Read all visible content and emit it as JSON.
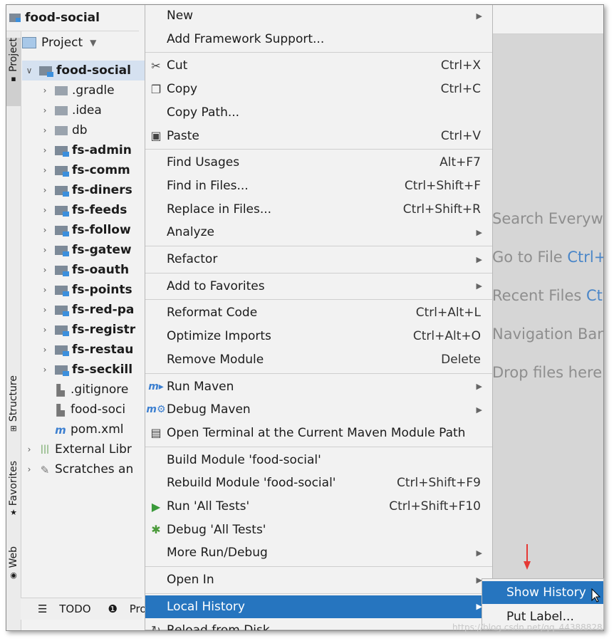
{
  "project": {
    "name": "food-social",
    "view_label": "Project"
  },
  "side_tabs": {
    "project": "Project",
    "structure": "Structure",
    "favorites": "Favorites",
    "web": "Web"
  },
  "tree": [
    {
      "label": "food-social",
      "bold": true,
      "arrow": "∨",
      "icon": "module-folder",
      "selected": true
    },
    {
      "label": ".gradle",
      "arrow": "›",
      "icon": "folder"
    },
    {
      "label": ".idea",
      "arrow": "›",
      "icon": "folder"
    },
    {
      "label": "db",
      "arrow": "›",
      "icon": "folder"
    },
    {
      "label": "fs-admin",
      "bold": true,
      "arrow": "›",
      "icon": "module-folder"
    },
    {
      "label": "fs-comm",
      "bold": true,
      "arrow": "›",
      "icon": "module-folder"
    },
    {
      "label": "fs-diners",
      "bold": true,
      "arrow": "›",
      "icon": "module-folder"
    },
    {
      "label": "fs-feeds",
      "bold": true,
      "arrow": "›",
      "icon": "module-folder"
    },
    {
      "label": "fs-follow",
      "bold": true,
      "arrow": "›",
      "icon": "module-folder"
    },
    {
      "label": "fs-gatew",
      "bold": true,
      "arrow": "›",
      "icon": "module-folder"
    },
    {
      "label": "fs-oauth",
      "bold": true,
      "arrow": "›",
      "icon": "module-folder"
    },
    {
      "label": "fs-points",
      "bold": true,
      "arrow": "›",
      "icon": "module-folder"
    },
    {
      "label": "fs-red-pa",
      "bold": true,
      "arrow": "›",
      "icon": "module-folder"
    },
    {
      "label": "fs-registr",
      "bold": true,
      "arrow": "›",
      "icon": "module-folder"
    },
    {
      "label": "fs-restau",
      "bold": true,
      "arrow": "›",
      "icon": "module-folder"
    },
    {
      "label": "fs-seckill",
      "bold": true,
      "arrow": "›",
      "icon": "module-folder"
    },
    {
      "label": ".gitignore",
      "arrow": "",
      "icon": "gitignore-file"
    },
    {
      "label": "food-soci",
      "arrow": "",
      "icon": "iml-file"
    },
    {
      "label": "pom.xml",
      "arrow": "",
      "icon": "maven-file"
    },
    {
      "label": "External Libr",
      "arrow": "›",
      "icon": "library"
    },
    {
      "label": "Scratches an",
      "arrow": "›",
      "icon": "scratches"
    }
  ],
  "bottom_tabs": {
    "todo": "TODO",
    "problems": "Probl"
  },
  "editor_hints": [
    {
      "text": "Search Everywh",
      "key": ""
    },
    {
      "text": "Go to File ",
      "key": "Ctrl+"
    },
    {
      "text": "Recent Files ",
      "key": "Ct"
    },
    {
      "text": "Navigation Bar",
      "key": ""
    },
    {
      "text": "Drop files here",
      "key": ""
    }
  ],
  "menu": [
    {
      "label": "New",
      "shortcut": "",
      "submenu": true,
      "icon": ""
    },
    {
      "label": "Add Framework Support...",
      "shortcut": "",
      "submenu": false,
      "icon": ""
    },
    {
      "sep": true
    },
    {
      "label": "Cut",
      "shortcut": "Ctrl+X",
      "submenu": false,
      "icon": "✂"
    },
    {
      "label": "Copy",
      "shortcut": "Ctrl+C",
      "submenu": false,
      "icon": "❐"
    },
    {
      "label": "Copy Path...",
      "shortcut": "",
      "submenu": false,
      "icon": ""
    },
    {
      "label": "Paste",
      "shortcut": "Ctrl+V",
      "submenu": false,
      "icon": "▣"
    },
    {
      "sep": true
    },
    {
      "label": "Find Usages",
      "shortcut": "Alt+F7",
      "submenu": false,
      "icon": ""
    },
    {
      "label": "Find in Files...",
      "shortcut": "Ctrl+Shift+F",
      "submenu": false,
      "icon": ""
    },
    {
      "label": "Replace in Files...",
      "shortcut": "Ctrl+Shift+R",
      "submenu": false,
      "icon": ""
    },
    {
      "label": "Analyze",
      "shortcut": "",
      "submenu": true,
      "icon": ""
    },
    {
      "sep": true
    },
    {
      "label": "Refactor",
      "shortcut": "",
      "submenu": true,
      "icon": ""
    },
    {
      "sep": true
    },
    {
      "label": "Add to Favorites",
      "shortcut": "",
      "submenu": true,
      "icon": ""
    },
    {
      "sep": true
    },
    {
      "label": "Reformat Code",
      "shortcut": "Ctrl+Alt+L",
      "submenu": false,
      "icon": ""
    },
    {
      "label": "Optimize Imports",
      "shortcut": "Ctrl+Alt+O",
      "submenu": false,
      "icon": ""
    },
    {
      "label": "Remove Module",
      "shortcut": "Delete",
      "submenu": false,
      "icon": ""
    },
    {
      "sep": true
    },
    {
      "label": "Run Maven",
      "shortcut": "",
      "submenu": true,
      "icon": "m▸"
    },
    {
      "label": "Debug Maven",
      "shortcut": "",
      "submenu": true,
      "icon": "m⚙"
    },
    {
      "label": "Open Terminal at the Current Maven Module Path",
      "shortcut": "",
      "submenu": false,
      "icon": "▤"
    },
    {
      "sep": true
    },
    {
      "label": "Build Module 'food-social'",
      "shortcut": "",
      "submenu": false,
      "icon": ""
    },
    {
      "label": "Rebuild Module 'food-social'",
      "shortcut": "Ctrl+Shift+F9",
      "submenu": false,
      "icon": ""
    },
    {
      "label": "Run 'All Tests'",
      "shortcut": "Ctrl+Shift+F10",
      "submenu": false,
      "icon": "▶"
    },
    {
      "label": "Debug 'All Tests'",
      "shortcut": "",
      "submenu": false,
      "icon": "✱"
    },
    {
      "label": "More Run/Debug",
      "shortcut": "",
      "submenu": true,
      "icon": ""
    },
    {
      "sep": true
    },
    {
      "label": "Open In",
      "shortcut": "",
      "submenu": true,
      "icon": ""
    },
    {
      "sep": true
    },
    {
      "label": "Local History",
      "shortcut": "",
      "submenu": true,
      "icon": "",
      "active": true
    },
    {
      "label": "Reload from Disk",
      "shortcut": "",
      "submenu": false,
      "icon": "↻"
    }
  ],
  "submenu": [
    {
      "label": "Show History",
      "active": true
    },
    {
      "label": "Put Label...",
      "active": false
    }
  ],
  "watermark": "https://blog.csdn.net/qq_44388828",
  "colors": {
    "accent": "#2675bf",
    "selection": "#d5e1f0",
    "arrow_red": "#e53935",
    "hint_key": "#4a86c8"
  }
}
